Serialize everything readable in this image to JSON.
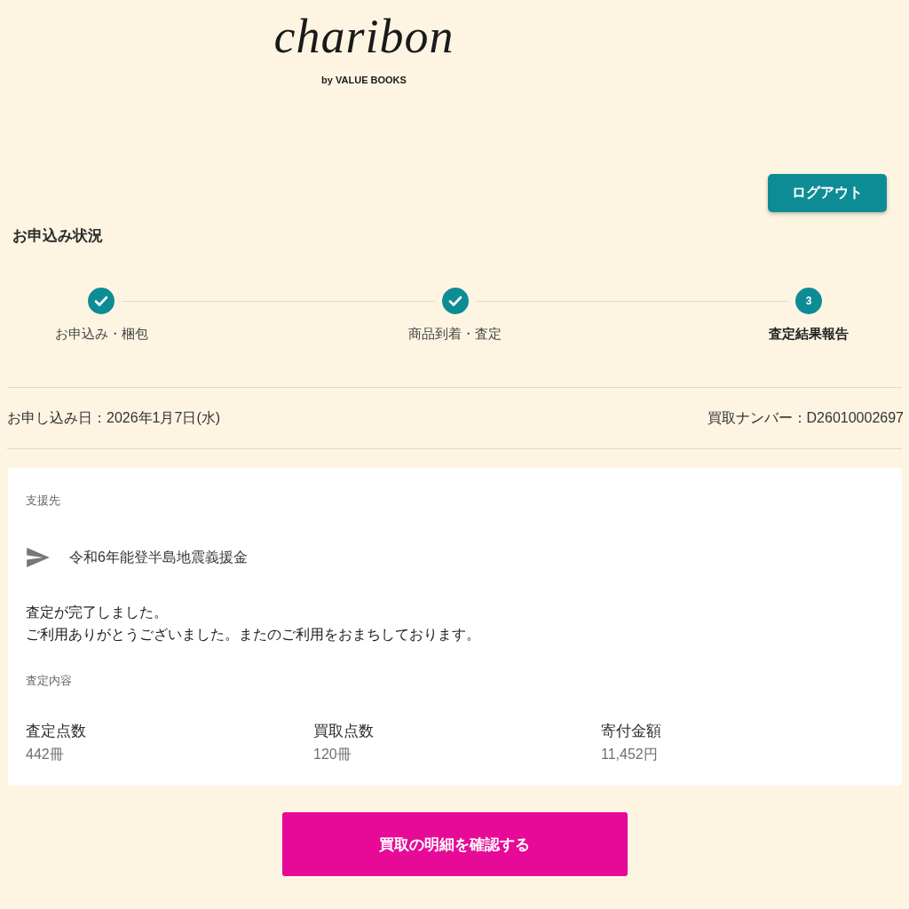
{
  "header": {
    "logo": "charibon",
    "byline": "by VALUE BOOKS",
    "logout_button": "ログアウト"
  },
  "status": {
    "title": "お申込み状況",
    "steps": [
      {
        "label": "お申込み・梱包",
        "completed": true,
        "selected": false
      },
      {
        "label": "商品到着・査定",
        "completed": true,
        "selected": false
      },
      {
        "label": "査定結果報告",
        "completed": false,
        "selected": true,
        "number": "3"
      }
    ]
  },
  "application": {
    "date": "お申し込み日：2026年1月7日(水)",
    "purchase_number": "買取ナンバー：D26010002697"
  },
  "card": {
    "recipient_heading": "支援先",
    "recipient": "令和6年能登半島地震義援金",
    "message": [
      "査定が完了しました。",
      "ご利用ありがとうございました。またのご利用をおまちしております。"
    ],
    "results_heading": "査定内容",
    "results": [
      {
        "label": "査定点数",
        "value": "442冊"
      },
      {
        "label": "買取点数",
        "value": "120冊"
      },
      {
        "label": "寄付金額",
        "value": "11,452円"
      }
    ]
  },
  "details_button": "買取の明細を確認する"
}
